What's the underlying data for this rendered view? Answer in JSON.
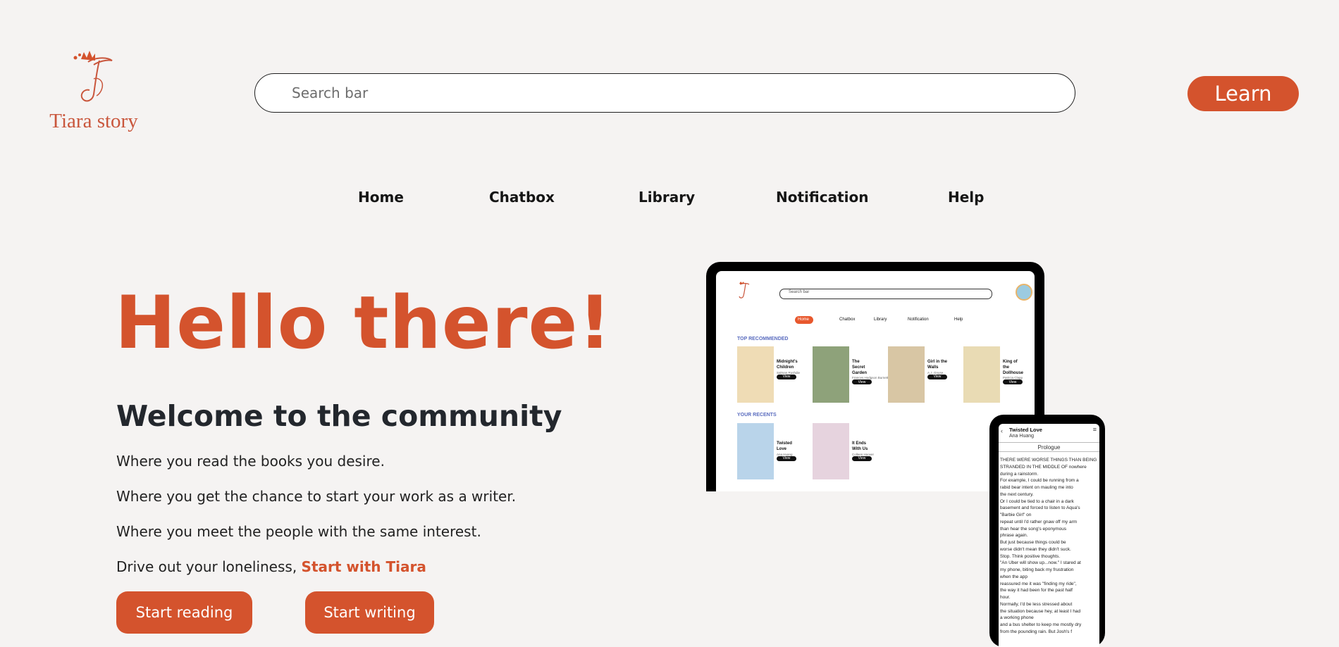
{
  "header": {
    "logo_text": "Tiara story",
    "search_placeholder": "Search bar",
    "learn_label": "Learn"
  },
  "nav": [
    "Home",
    "Chatbox",
    "Library",
    "Notification",
    "Help"
  ],
  "hero": {
    "title": "Hello there!",
    "subtitle": "Welcome to the community",
    "lines": [
      "Where you read the books you desire.",
      "Where you get the chance to start your work as a writer.",
      "Where you meet the people with the same interest."
    ],
    "cta_prefix": "Drive out your loneliness, ",
    "cta_link": "Start with Tiara",
    "buttons": {
      "read": "Start reading",
      "write": "Start writing"
    }
  },
  "mockup": {
    "laptop": {
      "search_placeholder": "Search bar",
      "nav": [
        "Home",
        "Chatbox",
        "Library",
        "Notification",
        "Help"
      ],
      "section_recommended": "TOP RECOMMENDED",
      "section_recents": "YOUR RECENTS",
      "view_label": "View",
      "recommended": [
        {
          "title": "Midnight's Children",
          "author": "Salman Rushdie",
          "cover": "#efdcb5"
        },
        {
          "title": "The Secret Garden",
          "author": "Frances Hodgson Burnett",
          "cover": "#8ea27a"
        },
        {
          "title": "Girl in the Walls",
          "author": "A.J. Gnuse",
          "cover": "#d8c6a4"
        },
        {
          "title": "King of the Dollhouse",
          "author": "Patricia Clapp",
          "cover": "#e9dbb4"
        }
      ],
      "recents": [
        {
          "title": "Twisted Love",
          "author": "Ana Huang",
          "cover": "#b9d4ea"
        },
        {
          "title": "It Ends With Us",
          "author": "Colleen Hoover",
          "cover": "#e6d3de"
        }
      ]
    },
    "phone": {
      "title": "Twisted Love",
      "author": "Ana Huang",
      "chapter": "Prologue",
      "body": [
        "THERE WERE WORSE THINGS THAN BEING",
        "STRANDED IN THE MIDDLE OF nowhere",
        "during a rainstorm.",
        "For example, I could be running from a",
        "rabid bear intent on mauling me into",
        "the next century.",
        "Or I could be tied to a chair in a dark",
        "basement and forced to listen to Aqua's",
        "\"Barbie Girl\" on",
        "repeat until I'd rather gnaw off my arm",
        "than hear the song's eponymous",
        "phrase again.",
        "  But just because things could be",
        "worse didn't mean they didn't suck.",
        "  Stop. Think positive thoughts.",
        "  \"An Uber will show up...now.\" I stared at",
        "my phone, biting back my frustration",
        "when the app",
        "reassured me it was \"finding my ride\",",
        "the way it had been for the past half",
        "hour.",
        "  Normally, I'd be less stressed about",
        "the situation because hey, at least I had",
        "a working phone",
        "and a bus shelter to keep me mostly dry",
        "from the pounding rain. But Josh's f"
      ]
    }
  }
}
